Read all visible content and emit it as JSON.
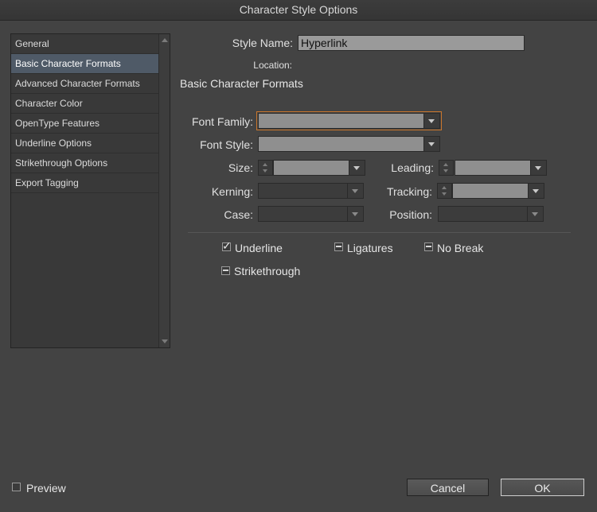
{
  "window": {
    "title": "Character Style Options"
  },
  "sidebar": {
    "items": [
      {
        "label": "General"
      },
      {
        "label": "Basic Character Formats",
        "selected": true
      },
      {
        "label": "Advanced Character Formats"
      },
      {
        "label": "Character Color"
      },
      {
        "label": "OpenType Features"
      },
      {
        "label": "Underline Options"
      },
      {
        "label": "Strikethrough Options"
      },
      {
        "label": "Export Tagging"
      }
    ]
  },
  "form": {
    "style_name_label": "Style Name:",
    "style_name_value": "Hyperlink",
    "location_label": "Location:",
    "section_heading": "Basic Character Formats",
    "font_family_label": "Font Family:",
    "font_style_label": "Font Style:",
    "size_label": "Size:",
    "leading_label": "Leading:",
    "kerning_label": "Kerning:",
    "tracking_label": "Tracking:",
    "case_label": "Case:",
    "position_label": "Position:"
  },
  "options": {
    "underline": {
      "label": "Underline",
      "state": "checked"
    },
    "ligatures": {
      "label": "Ligatures",
      "state": "mixed"
    },
    "no_break": {
      "label": "No Break",
      "state": "mixed"
    },
    "strikethrough": {
      "label": "Strikethrough",
      "state": "mixed"
    }
  },
  "footer": {
    "preview_label": "Preview",
    "cancel_label": "Cancel",
    "ok_label": "OK"
  },
  "colors": {
    "background": "#434343",
    "selected_item": "#4f5a67",
    "focus_ring": "#c9762c"
  }
}
